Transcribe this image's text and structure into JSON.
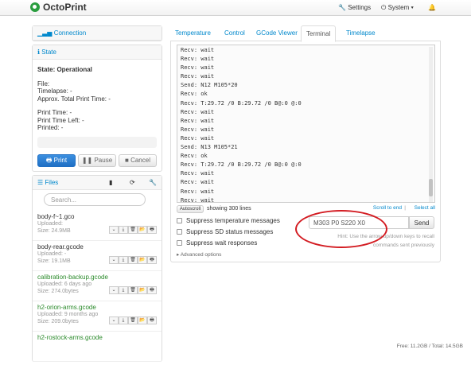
{
  "navbar": {
    "brand": "OctoPrint",
    "settings": "Settings",
    "system": "System",
    "wrench_icon": "wrench-icon",
    "power_icon": "power-icon",
    "bell_icon": "bell-icon"
  },
  "sidebar": {
    "connection_label": "Connection",
    "state_label": "State",
    "state_value": "State: Operational",
    "file": "File:",
    "timelapse": "Timelapse: -",
    "approx": "Approx. Total Print Time: -",
    "print_time": "Print Time: -",
    "print_time_left": "Print Time Left: -",
    "printed": "Printed: -",
    "progress": 0,
    "buttons": {
      "print": "Print",
      "pause": "Pause",
      "cancel": "Cancel"
    },
    "files_label": "Files",
    "search_placeholder": "Search...",
    "files": [
      {
        "name": "body-f~1.gco",
        "uploaded": "Uploaded:",
        "size": "Size: 24.9MB",
        "color": "#333333"
      },
      {
        "name": "body-rear.gcode",
        "uploaded": "Uploaded: -",
        "size": "Size: 19.1MB",
        "color": "#333333"
      },
      {
        "name": "calibration-backup.gcode",
        "uploaded": "Uploaded: 6 days ago",
        "size": "Size: 274.0bytes",
        "color": "#2a8a2a"
      },
      {
        "name": "h2-orion-arms.gcode",
        "uploaded": "Uploaded: 9 months ago",
        "size": "Size: 209.0bytes",
        "color": "#2a8a2a"
      },
      {
        "name": "h2-rostock-arms.gcode",
        "uploaded": "",
        "size": "",
        "color": "#2a8a2a"
      }
    ],
    "free_space": "Free: 11.2GB / Total: 14.5GB"
  },
  "tabs": [
    "Temperature",
    "Control",
    "GCode Viewer",
    "Terminal",
    "Timelapse"
  ],
  "active_tab": "Terminal",
  "terminal": {
    "lines": [
      "Recv: wait",
      "Recv: wait",
      "Recv: wait",
      "Recv: wait",
      "Send: N12 M105*20",
      "Recv: ok",
      "Recv: T:29.72 /0 B:29.72 /0 B@:0 @:0",
      "Recv: wait",
      "Recv: wait",
      "Recv: wait",
      "Recv: wait",
      "Send: N13 M105*21",
      "Recv: ok",
      "Recv: T:29.72 /0 B:29.72 /0 B@:0 @:0",
      "Recv: wait",
      "Recv: wait",
      "Recv: wait",
      "Recv: wait"
    ],
    "autoscroll": "Autoscroll",
    "showing": "showing 300 lines",
    "scroll_to_end": "Scroll to end",
    "select_all": "Select all",
    "suppress_temp": "Suppress temperature messages",
    "suppress_sd": "Suppress SD status messages",
    "suppress_wait": "Suppress wait responses",
    "command_value": "M303 P0 S220 X0",
    "send": "Send",
    "hint_line1": "Hint: Use the arrow up/down keys to recall",
    "hint_line2": "commands sent previously",
    "advanced": "Advanced options"
  },
  "annotation_color": "#d31c22"
}
